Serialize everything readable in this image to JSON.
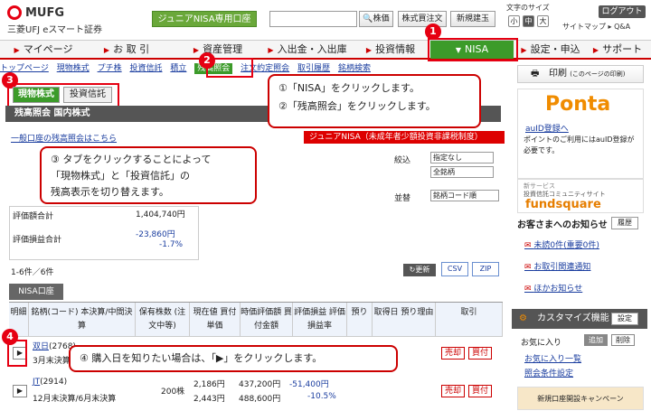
{
  "header": {
    "brand": "MUFG",
    "brand_sub": "三菱UFJ eスマート証券",
    "junior_nisa_btn": "ジュニアNISA専用口座",
    "search_btn": "株価",
    "quote_btn": "株式買注文",
    "new_order_btn": "新規建玉",
    "font_size_label": "文字のサイズ",
    "font_small": "小",
    "font_mid": "中",
    "font_large": "大",
    "logout": "ログアウト",
    "top_links": "サイトマップ ▸ Q&A"
  },
  "nav": {
    "items": [
      "マイページ",
      "お 取 引",
      "資産管理",
      "入出金・入出庫",
      "投資情報",
      "NISA",
      "設定・申込",
      "サポート"
    ]
  },
  "subnav": {
    "items": [
      "トップページ",
      "現物株式",
      "プチ株",
      "投資信託",
      "積立",
      "残高照会",
      "注文約定照会",
      "取引履歴",
      "銘柄検索"
    ],
    "active": "残高照会"
  },
  "tabs": {
    "stock": "現物株式",
    "fund": "投資信託"
  },
  "section_title": "残高照会 国内株式",
  "general_link": "一般口座の残高照会はこちら",
  "junior_banner": "ジュニアNISA（未成年者少額投資非課税制度）",
  "filter": {
    "narrow_label": "絞込",
    "opt1": "指定なし",
    "opt2": "全銘柄",
    "sort_label": "並替",
    "sort_value": "銘柄コード順"
  },
  "summary": {
    "eval_total_label": "評価額合計",
    "eval_total": "1,404,740円",
    "pl_label": "評価損益合計",
    "pl_value": "-23,860円",
    "pl_pct": "-1.7%"
  },
  "count": "1-6件／6件",
  "refresh_btn": "更新",
  "csv_btn": "CSV",
  "zip_btn": "ZIP",
  "nisa_tab": "NISA口座",
  "table": {
    "headers": [
      "明細",
      "銘柄(コード) 本決算/中間決算",
      "保有株数 (注文中等)",
      "現在値 買付単価",
      "時価評価額 買付金額",
      "評価損益 評価損益率",
      "預り",
      "取得日 預り理由",
      "取引"
    ],
    "rows": [
      {
        "name": "双日",
        "code": "(2768)",
        "term": "3月末決算",
        "shares": "",
        "price": "",
        "cost": "",
        "eval": "",
        "buy_amt": "",
        "pl": "",
        "pl_pct": "",
        "sell": "売却",
        "buy": "買付"
      },
      {
        "name": "JT",
        "code": "(2914)",
        "term": "12月末決算/6月末決算",
        "shares": "200株",
        "price": "2,186円",
        "cost": "2,443円",
        "eval": "437,200円",
        "buy_amt": "488,600円",
        "pl": "-51,400円",
        "pl_pct": "-10.5%",
        "sell": "売却",
        "buy": "買付"
      }
    ]
  },
  "sidebar": {
    "print": "印刷",
    "print_sub": "(このページの印刷)",
    "ponta_logo": "Ponta",
    "ponta_link": "auID登録へ",
    "ponta_text": "ポイントのご利用にはauID登録が必要です。",
    "fund_new": "新サービス",
    "fund_sub": "投資信託コミュニティサイト",
    "fund_logo": "fundsquare",
    "notice_title": "お客さまへのお知らせ",
    "history_btn": "履歴",
    "notice_items": [
      "未読0件(重要0件)",
      "お取引関連通知",
      "ほかお知らせ"
    ],
    "custom_title": "カスタマイズ機能",
    "custom_btn": "設定",
    "fav_label": "お気に入り",
    "fav_add": "追加",
    "fav_del": "削除",
    "fav_link": "お気に入り一覧",
    "stock_link": "照会条件設定",
    "bottom_banner": "新規口座開設キャンペーン"
  },
  "callouts": {
    "c1": "①「NISA」をクリックします。",
    "c2": "②「残高照会」をクリックします。",
    "c3a": "③ タブをクリックすることによって",
    "c3b": "「現物株式」と「投資信託」の",
    "c3c": "残高表示を切り替えます。",
    "c4": "④ 購入日を知りたい場合は、「▶」をクリックします。"
  },
  "markers": {
    "m1": "1",
    "m2": "2",
    "m3": "3",
    "m4": "4"
  },
  "colors": {
    "accent": "#3c9b2a",
    "highlight": "#e60012"
  }
}
